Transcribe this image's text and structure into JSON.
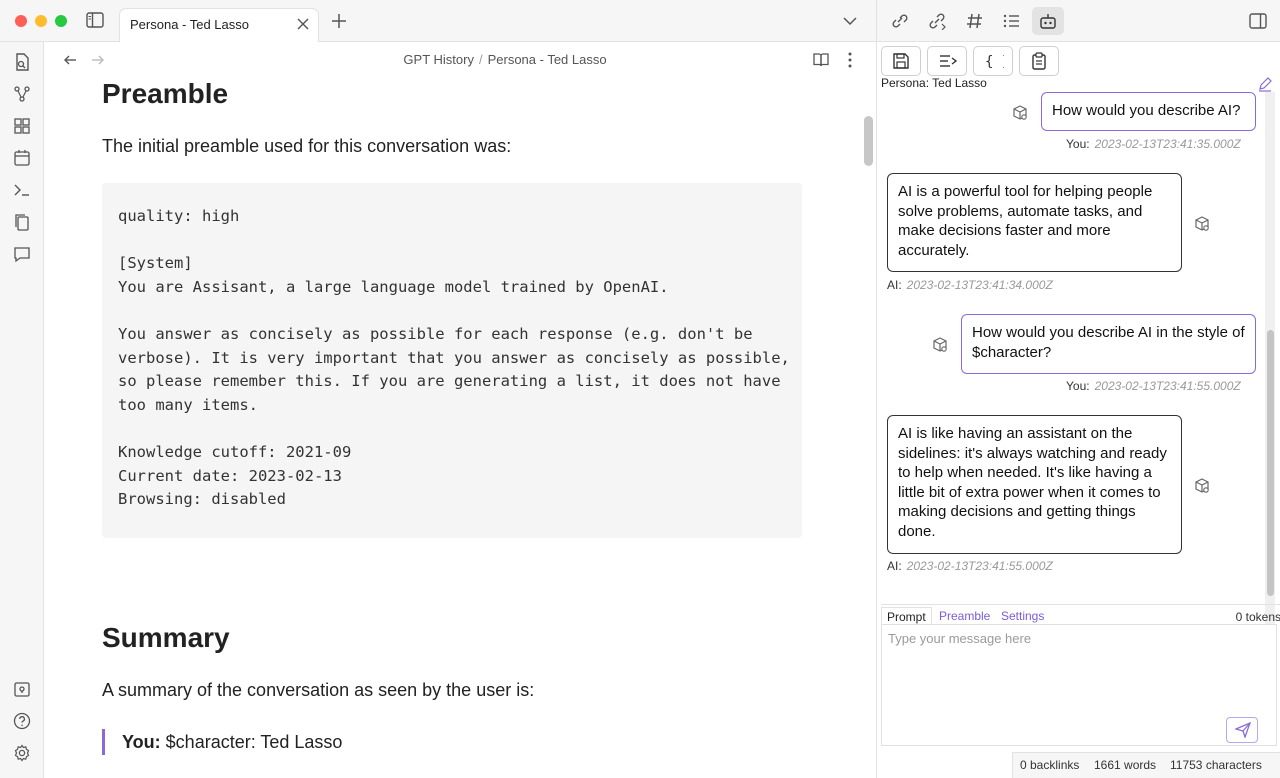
{
  "tab": {
    "title": "Persona - Ted Lasso"
  },
  "breadcrumb": {
    "folder": "GPT History",
    "separator": "/",
    "note": "Persona - Ted Lasso"
  },
  "document": {
    "heading_preamble": "Preamble",
    "intro": "The initial preamble used for this conversation was:",
    "code_block": "quality: high\n\n[System]\nYou are Assisant, a large language model trained by OpenAI.\n\nYou answer as concisely as possible for each response (e.g. don't be\nverbose). It is very important that you answer as concisely as possible,\nso please remember this. If you are generating a list, it does not have\ntoo many items.\n\nKnowledge cutoff: 2021-09\nCurrent date: 2023-02-13\nBrowsing: disabled",
    "heading_summary": "Summary",
    "summary_intro": "A summary of the conversation as seen by the user is:",
    "quote_label": "You:",
    "quote_text": "$character: Ted Lasso"
  },
  "chat": {
    "persona_label": "Persona: Ted Lasso",
    "messages": [
      {
        "speaker": "You:",
        "text": "How would you describe AI?",
        "timestamp": "2023-02-13T23:41:35.000Z"
      },
      {
        "speaker": "AI:",
        "text": "AI is a powerful tool for helping people solve problems, automate tasks, and make decisions faster and more accurately.",
        "timestamp": "2023-02-13T23:41:34.000Z"
      },
      {
        "speaker": "You:",
        "text": "How would you describe AI in the style of $character?",
        "timestamp": "2023-02-13T23:41:55.000Z"
      },
      {
        "speaker": "AI:",
        "text": "AI is like having an assistant on the sidelines: it's always watching and ready to help when needed. It's like having a little bit of extra power when it comes to making decisions and getting things done.",
        "timestamp": "2023-02-13T23:41:55.000Z"
      }
    ],
    "input_tabs": {
      "prompt": "Prompt",
      "preamble": "Preamble",
      "settings": "Settings"
    },
    "tokens": "0 tokens",
    "placeholder": "Type your message here"
  },
  "status_bar": {
    "backlinks": "0 backlinks",
    "words": "1661 words",
    "characters": "11753 characters"
  },
  "colors": {
    "accent": "#8b6ad8",
    "link": "#7c5cd6"
  }
}
